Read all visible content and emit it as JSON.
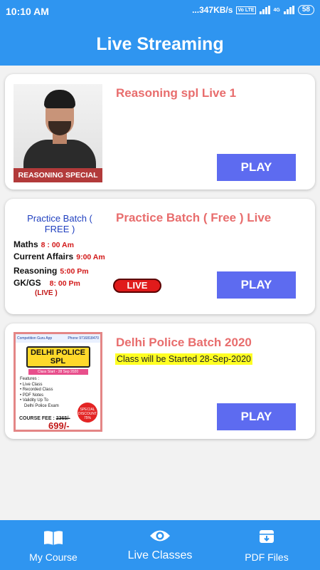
{
  "status_bar": {
    "time": "10:10 AM",
    "network_speed": "...347KB/s",
    "volte": "Vo LTE",
    "net_type": "4G",
    "battery": "58"
  },
  "app_bar": {
    "title": "Live Streaming"
  },
  "cards": [
    {
      "title": "Reasoning spl Live 1",
      "thumbnail_banner": "REASONING SPECIAL",
      "play_label": "PLAY"
    },
    {
      "title": "Practice Batch ( Free ) Live",
      "play_label": "PLAY",
      "live_badge": "LIVE",
      "thumbnail": {
        "heading": "Practice Batch ( FREE )",
        "rows": [
          {
            "subject": "Maths",
            "time": "8 : 00 Am"
          },
          {
            "subject": "Current Affairs",
            "time": "9:00 Am"
          },
          {
            "subject": "Reasoning",
            "time": "5:00 Pm"
          },
          {
            "subject": "GK/GS",
            "time": "8: 00 Pm"
          }
        ],
        "live_note": "(LIVE )"
      }
    },
    {
      "title": "Delhi Police Batch 2020",
      "subtitle": "Class will be Started 28-Sep-2020",
      "play_label": "PLAY",
      "thumbnail": {
        "brand": "Competition Guru App",
        "phone": "Phone 9716818470",
        "heading": "DELHI POLICE SPL",
        "start": "Class Start - 28 Sep 2020",
        "features_title": "Features :",
        "features": [
          "Live Class",
          "Recorded Class",
          "PDF Notes",
          "Validity Up To",
          "Delhi Police Exam"
        ],
        "fee_label": "COURSE FEE :",
        "old_price": "2365/-",
        "new_price": "699/-",
        "discount": "SPECIAL DISCOUNT 75%"
      }
    }
  ],
  "bottom_nav": [
    {
      "label": "My Course",
      "icon": "book-icon",
      "active": false
    },
    {
      "label": "Live Classes",
      "icon": "eye-icon",
      "active": true
    },
    {
      "label": "PDF Files",
      "icon": "archive-icon",
      "active": false
    }
  ],
  "colors": {
    "primary": "#2f95f0",
    "card_title": "#e86d6d",
    "play_button": "#5d6bf0",
    "live_badge": "#e01b1b",
    "highlight": "#ffff22"
  }
}
